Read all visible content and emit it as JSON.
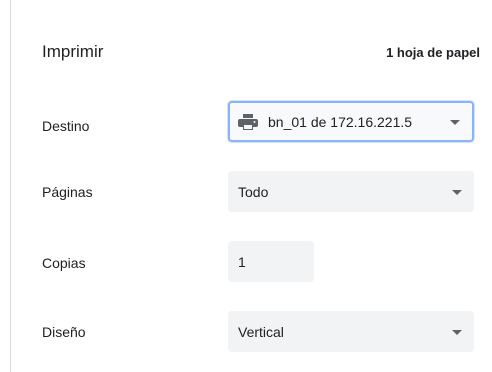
{
  "header": {
    "title": "Imprimir",
    "sheet_count": "1 hoja de papel"
  },
  "destination": {
    "label": "Destino",
    "value": "bn_01 de 172.16.221.5",
    "icon": "printer-icon"
  },
  "pages": {
    "label": "Páginas",
    "value": "Todo"
  },
  "copies": {
    "label": "Copias",
    "value": "1"
  },
  "layout": {
    "label": "Diseño",
    "value": "Vertical"
  },
  "colors": {
    "focus_border": "#8ab4f8",
    "field_bg": "#f1f3f4",
    "icon": "#5f6368"
  }
}
